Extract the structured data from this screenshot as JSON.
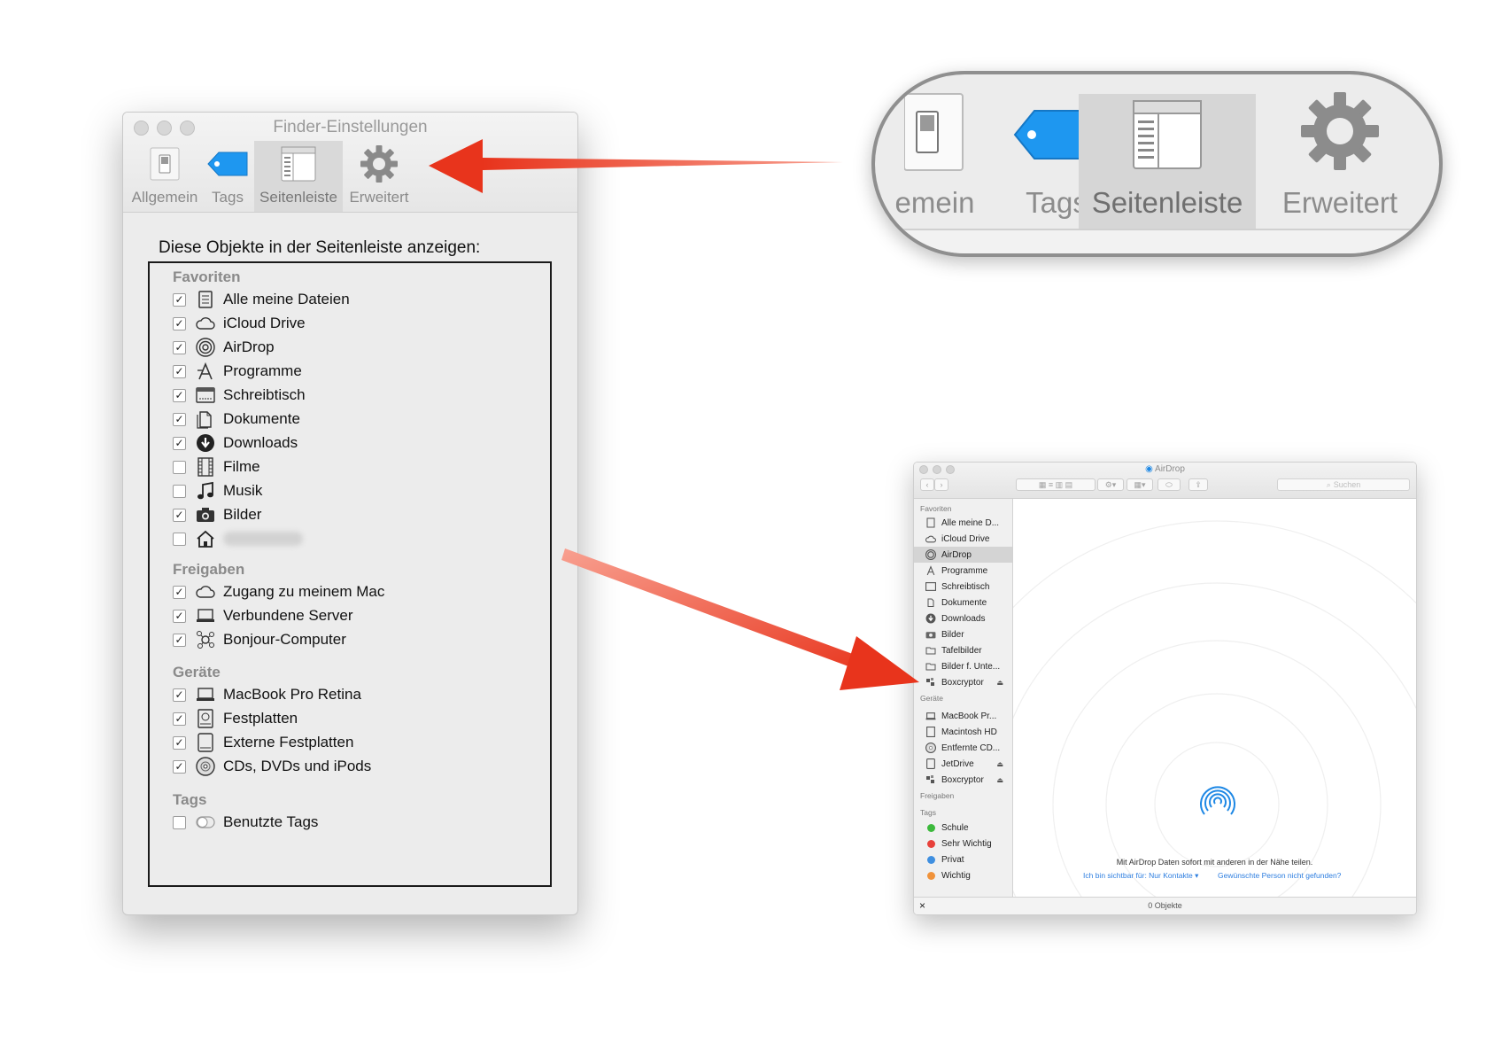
{
  "pref_window": {
    "title": "Finder-Einstellungen",
    "tabs": [
      {
        "label": "Allgemein",
        "icon": "switch-icon"
      },
      {
        "label": "Tags",
        "icon": "tag-icon"
      },
      {
        "label": "Seitenleiste",
        "icon": "sidebar-icon",
        "selected": true
      },
      {
        "label": "Erweitert",
        "icon": "gear-icon"
      }
    ],
    "heading": "Diese Objekte in der Seitenleiste anzeigen:",
    "sections": {
      "favoriten": {
        "title": "Favoriten",
        "items": [
          {
            "label": "Alle meine Dateien",
            "checked": true,
            "icon": "all-files-icon"
          },
          {
            "label": "iCloud Drive",
            "checked": true,
            "icon": "cloud-icon"
          },
          {
            "label": "AirDrop",
            "checked": true,
            "icon": "airdrop-icon"
          },
          {
            "label": "Programme",
            "checked": true,
            "icon": "applications-icon"
          },
          {
            "label": "Schreibtisch",
            "checked": true,
            "icon": "desktop-icon"
          },
          {
            "label": "Dokumente",
            "checked": true,
            "icon": "documents-icon"
          },
          {
            "label": "Downloads",
            "checked": true,
            "icon": "downloads-icon"
          },
          {
            "label": "Filme",
            "checked": false,
            "icon": "movies-icon"
          },
          {
            "label": "Musik",
            "checked": false,
            "icon": "music-icon"
          },
          {
            "label": "Bilder",
            "checked": true,
            "icon": "pictures-icon"
          },
          {
            "label": "",
            "checked": false,
            "icon": "home-icon",
            "blurred": true
          }
        ]
      },
      "freigaben": {
        "title": "Freigaben",
        "items": [
          {
            "label": "Zugang zu meinem Mac",
            "checked": true,
            "icon": "cloud-icon"
          },
          {
            "label": "Verbundene Server",
            "checked": true,
            "icon": "server-icon"
          },
          {
            "label": "Bonjour-Computer",
            "checked": true,
            "icon": "bonjour-icon"
          }
        ]
      },
      "geraete": {
        "title": "Geräte",
        "items": [
          {
            "label": "MacBook Pro Retina",
            "checked": true,
            "icon": "laptop-icon"
          },
          {
            "label": "Festplatten",
            "checked": true,
            "icon": "harddisk-icon"
          },
          {
            "label": "Externe Festplatten",
            "checked": true,
            "icon": "external-disk-icon"
          },
          {
            "label": "CDs, DVDs und iPods",
            "checked": true,
            "icon": "cd-icon"
          }
        ]
      },
      "tags": {
        "title": "Tags",
        "items": [
          {
            "label": "Benutzte Tags",
            "checked": false,
            "icon": "tag-toggle-icon"
          }
        ]
      }
    }
  },
  "callout": {
    "tabs": [
      {
        "label": "emein",
        "icon": "switch-icon"
      },
      {
        "label": "Tags",
        "icon": "tag-icon"
      },
      {
        "label": "Seitenleiste",
        "icon": "sidebar-icon",
        "selected": true
      },
      {
        "label": "Erweitert",
        "icon": "gear-icon"
      }
    ]
  },
  "finder": {
    "title": "AirDrop",
    "search_placeholder": "Suchen",
    "favoriten_title": "Favoriten",
    "favoriten": [
      {
        "label": "Alle meine D...",
        "icon": "all-files-icon"
      },
      {
        "label": "iCloud Drive",
        "icon": "cloud-icon"
      },
      {
        "label": "AirDrop",
        "icon": "airdrop-icon",
        "selected": true
      },
      {
        "label": "Programme",
        "icon": "applications-icon"
      },
      {
        "label": "Schreibtisch",
        "icon": "desktop-icon"
      },
      {
        "label": "Dokumente",
        "icon": "documents-icon"
      },
      {
        "label": "Downloads",
        "icon": "downloads-icon"
      },
      {
        "label": "Bilder",
        "icon": "pictures-icon"
      },
      {
        "label": "Tafelbilder",
        "icon": "folder-icon"
      },
      {
        "label": "Bilder f. Unte...",
        "icon": "folder-icon"
      },
      {
        "label": "Boxcryptor",
        "icon": "boxcryptor-icon",
        "eject": true
      }
    ],
    "geraete_title": "Geräte",
    "geraete": [
      {
        "label": "MacBook Pr...",
        "icon": "laptop-icon"
      },
      {
        "label": "Macintosh HD",
        "icon": "harddisk-icon"
      },
      {
        "label": "Entfernte CD...",
        "icon": "cd-icon"
      },
      {
        "label": "JetDrive",
        "icon": "external-disk-icon",
        "eject": true
      },
      {
        "label": "Boxcryptor",
        "icon": "boxcryptor-icon",
        "eject": true
      }
    ],
    "freigaben_title": "Freigaben",
    "tags_title": "Tags",
    "tags": [
      {
        "label": "Schule",
        "color": "#3cb93c"
      },
      {
        "label": "Sehr Wichtig",
        "color": "#e8413b"
      },
      {
        "label": "Privat",
        "color": "#3f8fe0"
      },
      {
        "label": "Wichtig",
        "color": "#f0923a"
      }
    ],
    "airdrop_message": "Mit AirDrop Daten sofort mit anderen in der Nähe teilen.",
    "link_visible": "Ich bin sichtbar für: Nur Kontakte",
    "link_not_found": "Gewünschte Person nicht gefunden?",
    "status": "0 Objekte",
    "close_glyph": "×"
  },
  "colors": {
    "arrow": "#e8341c",
    "airdrop_blue": "#1e88e5",
    "link": "#2d7ee0"
  }
}
